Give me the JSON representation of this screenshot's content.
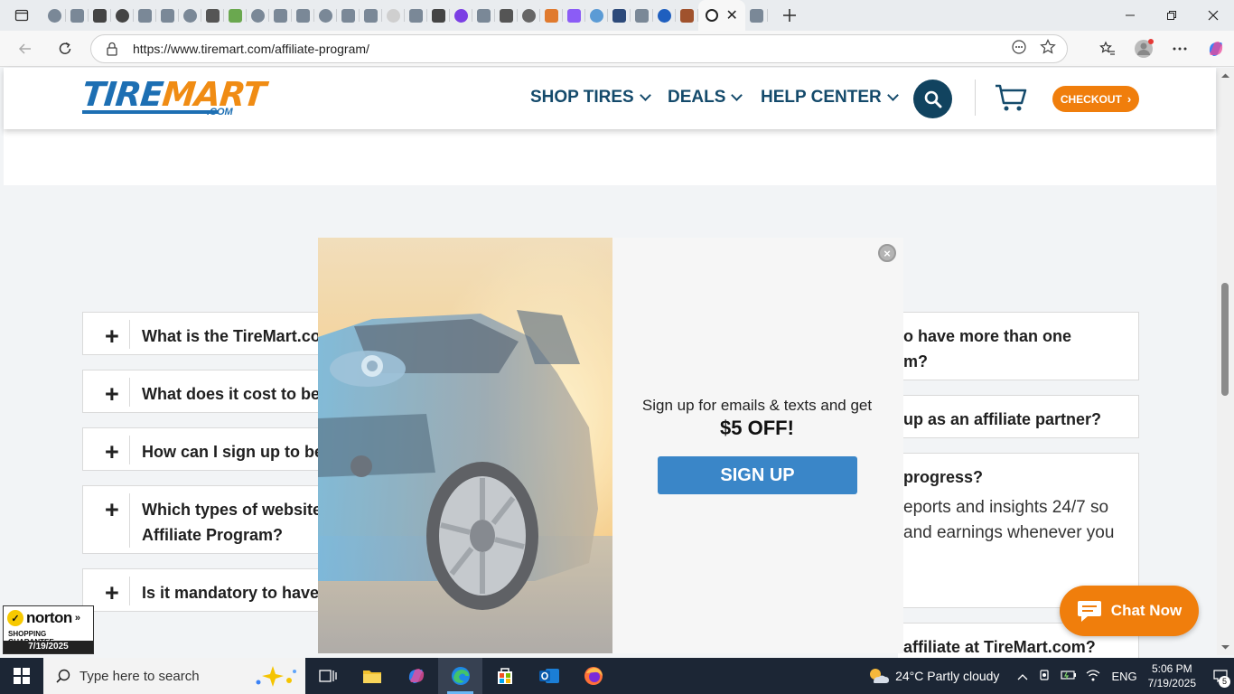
{
  "browser": {
    "url": "https://www.tiremart.com/affiliate-program/",
    "tab_favicon_colors": [
      "#7a8897",
      "#7a8897",
      "#444",
      "#444",
      "#7a8897",
      "#7a8897",
      "#7a8897",
      "#555",
      "#6aa84f",
      "#7a8897",
      "#7a8897",
      "#7a8897",
      "#7a8897",
      "#7a8897",
      "#7a8897",
      "#cfcfcf",
      "#7a8897",
      "#444",
      "#7b3fe4",
      "#7a8897",
      "#555",
      "#666",
      "#e07a2e",
      "#8b5cf6",
      "#5b9bd5",
      "#2d4a7a",
      "#7a8897",
      "#1f5fbf",
      "#a0522d",
      "#7a8897"
    ],
    "new_tab_icon": "plus-icon"
  },
  "site": {
    "logo_part1": "TIRE",
    "logo_part2": "MART",
    "logo_com": ".COM",
    "nav": [
      "SHOP TIRES",
      "DEALS",
      "HELP CENTER"
    ],
    "checkout_label": "CHECKOUT",
    "brand_blue": "#1d6fb3",
    "brand_orange": "#f07e0c"
  },
  "faq_left": [
    "What is the TireMart.co",
    "What does it cost to be",
    "How can I sign up to be",
    "Which types of website",
    "Is it mandatory to have"
  ],
  "faq_left_extra": "Affiliate Program?",
  "faq_right": {
    "item1_line1": "o have more than one",
    "item1_line2": "m?",
    "item2": "up as an affiliate partner?",
    "item3_q": "progress?",
    "item3_a1": "eports and insights 24/7 so",
    "item3_a2": "and earnings whenever you",
    "item4": "affiliate at TireMart.com?"
  },
  "modal": {
    "line1": "Sign up for emails & texts and get",
    "line2": "$5 OFF!",
    "button": "SIGN UP",
    "close_glyph": "×"
  },
  "norton": {
    "brand": "norton",
    "sub": "SHOPPING GUARANTEE",
    "date": "7/19/2025"
  },
  "chat": {
    "label": "Chat Now"
  },
  "taskbar": {
    "search_placeholder": "Type here to search",
    "weather": "24°C  Partly cloudy",
    "lang": "ENG",
    "time": "5:06 PM",
    "date": "7/19/2025",
    "notifications": "5"
  }
}
